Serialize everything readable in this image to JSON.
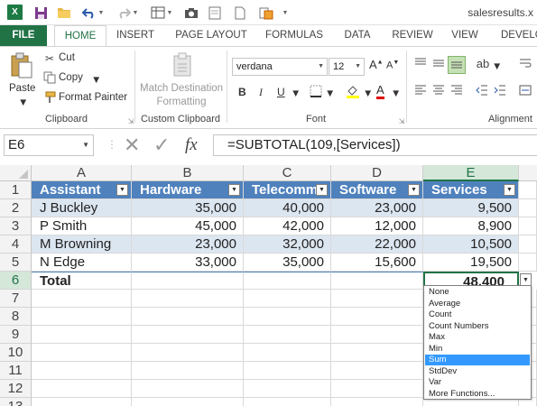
{
  "window": {
    "title": "salesresults.x"
  },
  "tabs": [
    "FILE",
    "HOME",
    "INSERT",
    "PAGE LAYOUT",
    "FORMULAS",
    "DATA",
    "REVIEW",
    "VIEW",
    "DEVELO"
  ],
  "ribbon": {
    "clipboard": {
      "paste": "Paste",
      "cut": "Cut",
      "copy": "Copy",
      "format_painter": "Format Painter",
      "label": "Clipboard"
    },
    "custom_clipboard": {
      "match_destination": "Match Destination",
      "formatting": "Formatting",
      "label": "Custom Clipboard"
    },
    "font": {
      "name": "verdana",
      "size": "12",
      "bold": "B",
      "italic": "I",
      "underline": "U",
      "font_color": "A",
      "label": "Font"
    },
    "alignment": {
      "label": "Alignment"
    }
  },
  "formula_bar": {
    "cell_ref": "E6",
    "fx": "fx",
    "formula": "=SUBTOTAL(109,[Services])"
  },
  "grid": {
    "columns": [
      "A",
      "B",
      "C",
      "D",
      "E"
    ],
    "rows": [
      "1",
      "2",
      "3",
      "4",
      "5",
      "6",
      "7",
      "8",
      "9",
      "10",
      "11",
      "12",
      "13"
    ],
    "header": [
      "Assistant",
      "Hardware",
      "Telecomm",
      "Software",
      "Services"
    ],
    "data": [
      [
        "J Buckley",
        "35,000",
        "40,000",
        "23,000",
        "9,500"
      ],
      [
        "P Smith",
        "45,000",
        "42,000",
        "12,000",
        "8,900"
      ],
      [
        "M Browning",
        "23,000",
        "32,000",
        "22,000",
        "10,500"
      ],
      [
        "N Edge",
        "33,000",
        "35,000",
        "15,600",
        "19,500"
      ]
    ],
    "total_label": "Total",
    "total_value": "48,400"
  },
  "dropdown": {
    "items": [
      "None",
      "Average",
      "Count",
      "Count Numbers",
      "Max",
      "Min",
      "Sum",
      "StdDev",
      "Var",
      "More Functions..."
    ],
    "selected": "Sum"
  },
  "colors": {
    "excel_green": "#217346",
    "table_header": "#4f81bd",
    "band": "#dce6f1",
    "selection": "#3399ff"
  }
}
